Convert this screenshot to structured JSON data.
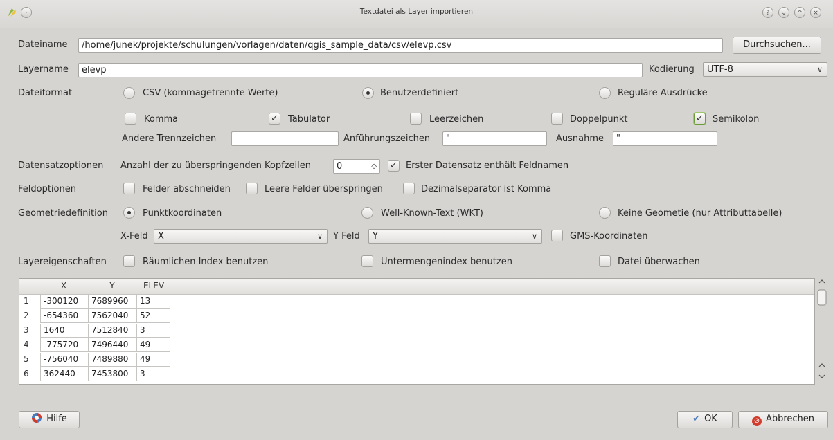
{
  "window": {
    "title": "Textdatei als Layer importieren"
  },
  "file": {
    "label": "Dateiname",
    "value": "/home/junek/projekte/schulungen/vorlagen/daten/qgis_sample_data/csv/elevp.csv",
    "browse": "Durchsuchen..."
  },
  "layer": {
    "label": "Layername",
    "value": "elevp",
    "encoding_label": "Kodierung",
    "encoding_value": "UTF-8"
  },
  "fileformat": {
    "label": "Dateiformat",
    "csv": "CSV (kommagetrennte Werte)",
    "custom": "Benutzerdefiniert",
    "regex": "Reguläre Ausdrücke"
  },
  "delimiters": {
    "comma": "Komma",
    "tab": "Tabulator",
    "space": "Leerzeichen",
    "colon": "Doppelpunkt",
    "semicolon": "Semikolon",
    "other_label": "Andere Trennzeichen",
    "other_value": "",
    "quote_label": "Anführungszeichen",
    "quote_value": "\"",
    "escape_label": "Ausnahme",
    "escape_value": "\""
  },
  "record": {
    "label": "Datensatzoptionen",
    "skip_label": "Anzahl der zu überspringenden Kopfzeilen",
    "skip_value": "0",
    "header_label": "Erster Datensatz enthält Feldnamen"
  },
  "fieldopts": {
    "label": "Feldoptionen",
    "trim": "Felder abschneiden",
    "skip_empty": "Leere Felder überspringen",
    "decimal_comma": "Dezimalseparator ist Komma"
  },
  "geometry": {
    "label": "Geometriedefinition",
    "point": "Punktkoordinaten",
    "wkt": "Well-Known-Text (WKT)",
    "none": "Keine Geometie (nur Attributtabelle)",
    "xfield_label": "X-Feld",
    "xfield_value": "X",
    "yfield_label": "Y Feld",
    "yfield_value": "Y",
    "dms": "GMS-Koordinaten"
  },
  "layerprops": {
    "label": "Layereigenschaften",
    "spatial_index": "Räumlichen Index benutzen",
    "subset_index": "Untermengenindex benutzen",
    "watch": "Datei überwachen"
  },
  "table": {
    "columns": [
      "X",
      "Y",
      "ELEV"
    ],
    "rows": [
      {
        "n": "1",
        "cells": [
          "-300120",
          "7689960",
          "13"
        ]
      },
      {
        "n": "2",
        "cells": [
          "-654360",
          "7562040",
          "52"
        ]
      },
      {
        "n": "3",
        "cells": [
          "1640",
          "7512840",
          "3"
        ]
      },
      {
        "n": "4",
        "cells": [
          "-775720",
          "7496440",
          "49"
        ]
      },
      {
        "n": "5",
        "cells": [
          "-756040",
          "7489880",
          "49"
        ]
      },
      {
        "n": "6",
        "cells": [
          "362440",
          "7453800",
          "3"
        ]
      }
    ]
  },
  "footer": {
    "help": "Hilfe",
    "ok": "OK",
    "cancel": "Abbrechen"
  },
  "colors": {
    "check_focus": "#6a9a3a",
    "cancel_icon": "#d23c2c",
    "ok_icon": "#4a7bbf"
  }
}
